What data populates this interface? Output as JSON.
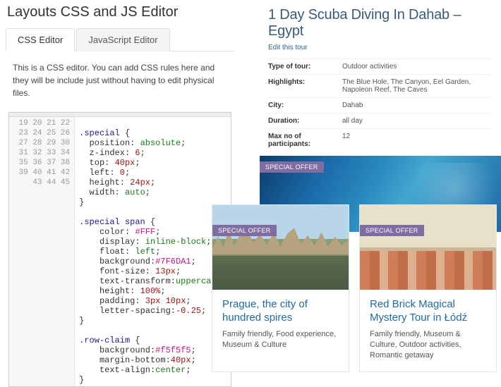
{
  "editor": {
    "title": "Layouts CSS and JS Editor",
    "tabs": {
      "css": "CSS Editor",
      "js": "JavaScript Editor"
    },
    "description": "This is a CSS editor. You can add CSS rules here and they will be include just without having to edit physical files.",
    "line_start": 19,
    "code_lines": [
      "",
      ".special {",
      "  position: absolute;",
      "  z-index: 6;",
      "  top: 40px;",
      "  left: 0;",
      "  height: 24px;",
      "  width: auto;",
      "}",
      "",
      ".special span {",
      "    color: #FFF;",
      "    display: inline-block;",
      "    float: left;",
      "    background:#7F6DA1;",
      "    font-size: 13px;",
      "    text-transform:uppercase;",
      "    height: 100%;",
      "    padding: 3px 10px;",
      "    letter-spacing:-0.25;",
      "}",
      "",
      ".row-claim {",
      "    background:#f5f5f5;",
      "    margin-bottom:40px;",
      "    text-align:center;",
      "}"
    ]
  },
  "tour": {
    "title": "1 Day Scuba Diving In Dahab – Egypt",
    "edit": "Edit this tour",
    "rows": [
      {
        "label": "Type of tour:",
        "value": "Outdoor activities"
      },
      {
        "label": "Highlights:",
        "value": "The Blue Hole, The Canyon, Eel Garden, Napoleon Reef, The Caves"
      },
      {
        "label": "City:",
        "value": "Dahab"
      },
      {
        "label": "Duration:",
        "value": "all day"
      },
      {
        "label": "Max no of participants:",
        "value": "12"
      }
    ],
    "special_label": "SPECIAL OFFER"
  },
  "cards": [
    {
      "special": "SPECIAL OFFER",
      "title": "Prague, the city of hundred spires",
      "tags": "Family friendly, Food experience, Museum & Culture"
    },
    {
      "special": "SPECIAL OFFER",
      "title": "Red Brick Magical Mystery Tour in Łódź",
      "tags": "Family friendly, Museum & Culture, Outdoor activities, Romantic getaway"
    }
  ]
}
